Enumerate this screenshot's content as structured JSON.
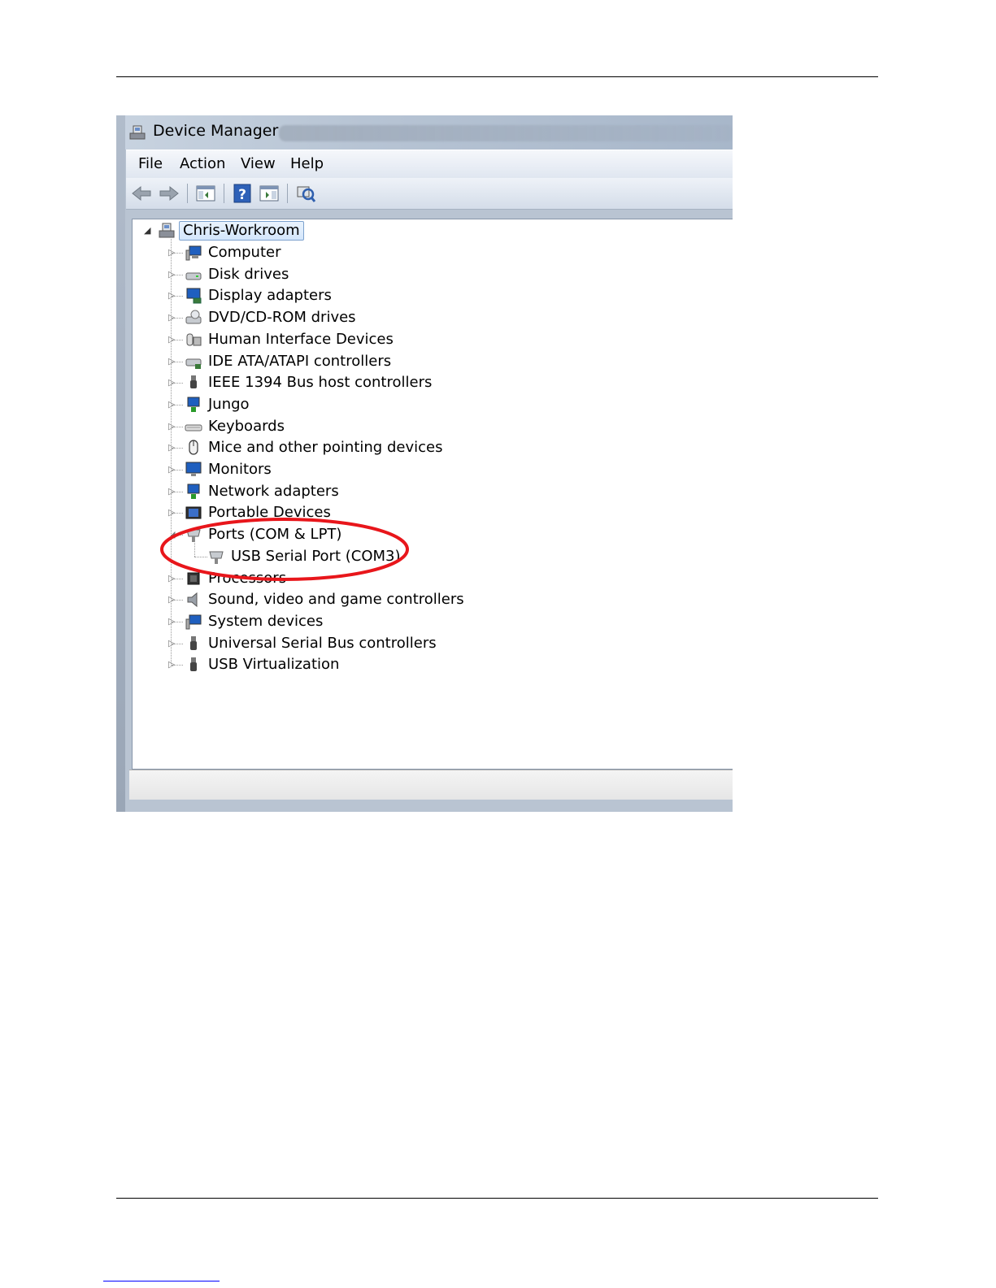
{
  "window": {
    "title": "Device Manager"
  },
  "menu": {
    "items": [
      "File",
      "Action",
      "View",
      "Help"
    ]
  },
  "toolbar": {
    "buttons": [
      "back-icon",
      "forward-icon",
      "show-hide-console-tree-icon",
      "help-icon",
      "show-action-pane-icon",
      "scan-hardware-changes-icon"
    ]
  },
  "tree": {
    "root": "Chris-Workroom",
    "categories": [
      {
        "label": "Computer",
        "icon": "computer-icon"
      },
      {
        "label": "Disk drives",
        "icon": "disk-drive-icon"
      },
      {
        "label": "Display adapters",
        "icon": "display-adapter-icon"
      },
      {
        "label": "DVD/CD-ROM drives",
        "icon": "dvd-drive-icon"
      },
      {
        "label": "Human Interface Devices",
        "icon": "hid-icon"
      },
      {
        "label": "IDE ATA/ATAPI controllers",
        "icon": "ide-controller-icon"
      },
      {
        "label": "IEEE 1394 Bus host controllers",
        "icon": "firewire-icon"
      },
      {
        "label": "Jungo",
        "icon": "jungo-icon"
      },
      {
        "label": "Keyboards",
        "icon": "keyboard-icon"
      },
      {
        "label": "Mice and other pointing devices",
        "icon": "mouse-icon"
      },
      {
        "label": "Monitors",
        "icon": "monitor-icon"
      },
      {
        "label": "Network adapters",
        "icon": "network-adapter-icon"
      },
      {
        "label": "Portable Devices",
        "icon": "portable-device-icon"
      },
      {
        "label": "Ports (COM & LPT)",
        "icon": "port-icon",
        "expanded": true,
        "children": [
          {
            "label": "USB Serial Port (COM3)",
            "icon": "port-icon"
          }
        ]
      },
      {
        "label": "Processors",
        "icon": "processor-icon"
      },
      {
        "label": "Sound, video and game controllers",
        "icon": "speaker-icon"
      },
      {
        "label": "System devices",
        "icon": "system-devices-icon"
      },
      {
        "label": "Universal Serial Bus controllers",
        "icon": "usb-icon"
      },
      {
        "label": "USB Virtualization",
        "icon": "usb-icon"
      }
    ]
  },
  "annotation": {
    "color": "#e8161b"
  }
}
